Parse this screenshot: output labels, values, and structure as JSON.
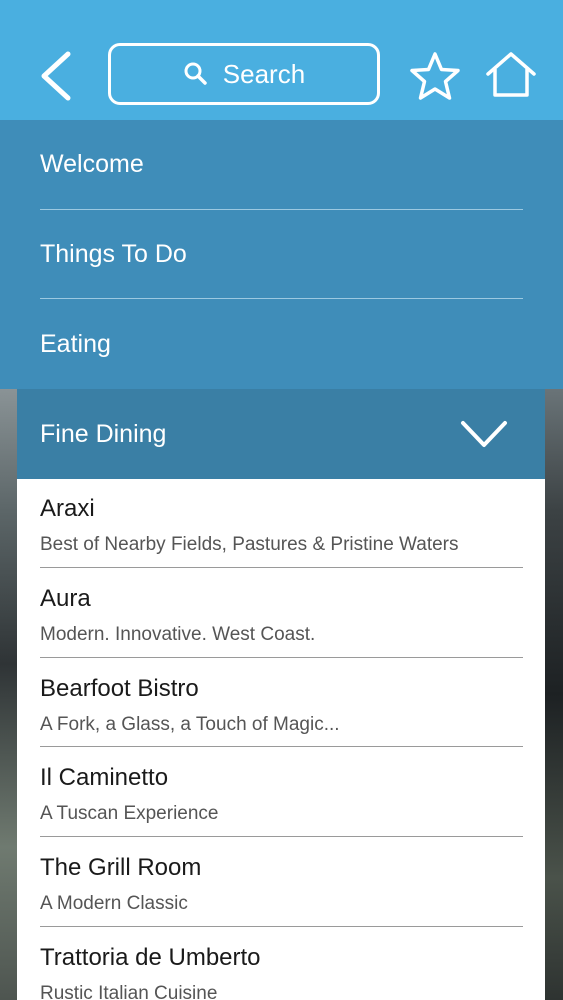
{
  "header": {
    "back_icon": "chevron-left-icon",
    "search": {
      "placeholder": "Search",
      "icon": "search-icon"
    },
    "favorite_icon": "star-icon",
    "home_icon": "home-icon",
    "color": "#4aafe0"
  },
  "menu": {
    "items": [
      {
        "label": "Welcome"
      },
      {
        "label": "Things To Do"
      },
      {
        "label": "Eating"
      }
    ],
    "color": "#3f8db9"
  },
  "section": {
    "label": "Fine Dining",
    "expand_icon": "chevron-down-icon",
    "color": "#3a7fa5",
    "restaurants": [
      {
        "name": "Araxi",
        "tagline": "Best of Nearby Fields, Pastures & Pristine Waters"
      },
      {
        "name": "Aura",
        "tagline": "Modern. Innovative. West Coast."
      },
      {
        "name": "Bearfoot Bistro",
        "tagline": "A Fork, a Glass, a Touch of Magic..."
      },
      {
        "name": "Il Caminetto",
        "tagline": "A Tuscan Experience"
      },
      {
        "name": "The Grill Room",
        "tagline": "A Modern Classic"
      },
      {
        "name": "Trattoria de Umberto",
        "tagline": "Rustic Italian Cuisine"
      }
    ]
  }
}
